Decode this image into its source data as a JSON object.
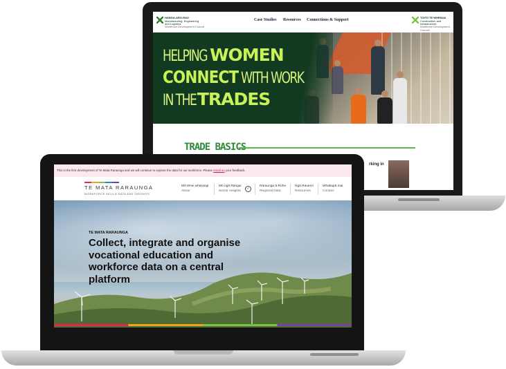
{
  "back_site": {
    "logo_lines": [
      "Manufacturing, Engineering",
      "and Logistics",
      "Workforce Development Council"
    ],
    "logo_brand": "HANGA-ARO-RAU",
    "nav": [
      "Case Studies",
      "Resources",
      "Connections & Support"
    ],
    "partner_logo_lines": [
      "TOITŪ TE WHENUA",
      "Construction and",
      "Infrastructure",
      "Workforce Development Council"
    ],
    "hero": {
      "line1_thin": "HELPING",
      "line1_bold": "WOMEN",
      "line2_bold": "CONNECT",
      "line2_thin": "WITH WORK",
      "line3_thin": "IN THE",
      "line3_bold": "TRADES"
    },
    "section_title": "TRADE BASICS",
    "side_title": "rking in"
  },
  "front_site": {
    "notice": "This is the first development of Te Mata Raraunga and we will continue to explore the data for our workforce. Please",
    "notice_link": "email us",
    "notice_end": "your feedback.",
    "brand": "TE MATA RARAUNGA",
    "brand_sub": "WORKFORCE SKILLS DATA AND INSIGHTS",
    "nav": [
      {
        "title": "Mō tēnei whārangi",
        "sub": "About"
      },
      {
        "title": "Mō ngā Rāngai",
        "sub": "Sector Insights"
      },
      {
        "title": "Raraunga ā-Rohe",
        "sub": "Regional Data"
      },
      {
        "title": "Ngā Rauemi",
        "sub": "Resources"
      },
      {
        "title": "Whakapā mai",
        "sub": "Contact"
      }
    ],
    "hero_kicker": "TE MATA RARAUNGA",
    "hero_headline": "Collect, integrate and organise vocational education and workforce data on a central platform"
  },
  "colors": {
    "back_hero_bg": "#123a21",
    "back_hero_accent": "#c9f15a",
    "trade_basics_green": "#2f8a3a",
    "notice_bg": "#fbe8ee",
    "notice_link": "#c4244a"
  },
  "icons": [
    "check-circle-icon",
    "hanga-aro-rau-logo-icon",
    "toitu-te-whenua-logo-icon"
  ]
}
